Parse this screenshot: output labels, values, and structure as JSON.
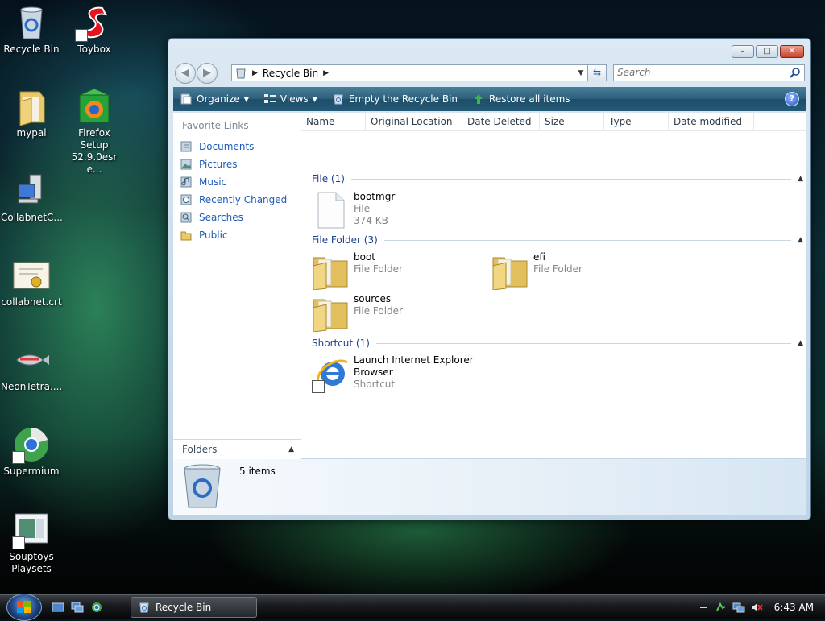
{
  "desktop": {
    "icons": [
      {
        "label": "Recycle Bin",
        "icon": "recycle-bin-icon"
      },
      {
        "label": "Toybox",
        "icon": "toybox-icon"
      },
      {
        "label": "mypal",
        "icon": "folder-icon"
      },
      {
        "label": "Firefox Setup 52.9.0esr e...",
        "icon": "firefox-setup-icon"
      },
      {
        "label": "CollabnetC...",
        "icon": "computer-icon"
      },
      {
        "label": "collabnet.crt",
        "icon": "certificate-icon"
      },
      {
        "label": "NeonTetra....",
        "icon": "fish-icon"
      },
      {
        "label": "Supermium",
        "icon": "supermium-icon"
      },
      {
        "label": "Souptoys Playsets",
        "icon": "souptoys-icon"
      }
    ]
  },
  "window": {
    "title": "Recycle Bin",
    "buttons": {
      "minimize": "–",
      "maximize": "□",
      "close": "✕"
    },
    "address": {
      "path_item": "Recycle Bin"
    },
    "search": {
      "placeholder": "Search"
    },
    "toolbar": {
      "organize": "Organize",
      "views": "Views",
      "empty": "Empty the Recycle Bin",
      "restore": "Restore all items"
    },
    "nav": {
      "favorite_links_header": "Favorite Links",
      "links": [
        "Documents",
        "Pictures",
        "Music",
        "Recently Changed",
        "Searches",
        "Public"
      ],
      "folders_label": "Folders"
    },
    "columns": [
      "Name",
      "Original Location",
      "Date Deleted",
      "Size",
      "Type",
      "Date modified"
    ],
    "groups": {
      "file": {
        "header": "File (1)",
        "items": [
          {
            "name": "bootmgr",
            "type": "File",
            "size": "374 KB"
          }
        ]
      },
      "folder": {
        "header": "File Folder (3)",
        "items": [
          {
            "name": "boot",
            "type": "File Folder"
          },
          {
            "name": "efi",
            "type": "File Folder"
          },
          {
            "name": "sources",
            "type": "File Folder"
          }
        ]
      },
      "shortcut": {
        "header": "Shortcut (1)",
        "items": [
          {
            "name_line1": "Launch Internet Explorer",
            "name_line2": "Browser",
            "type": "Shortcut"
          }
        ]
      }
    },
    "details": {
      "count": "5 items"
    }
  },
  "taskbar": {
    "task_label": "Recycle Bin",
    "clock": "6:43 AM"
  }
}
